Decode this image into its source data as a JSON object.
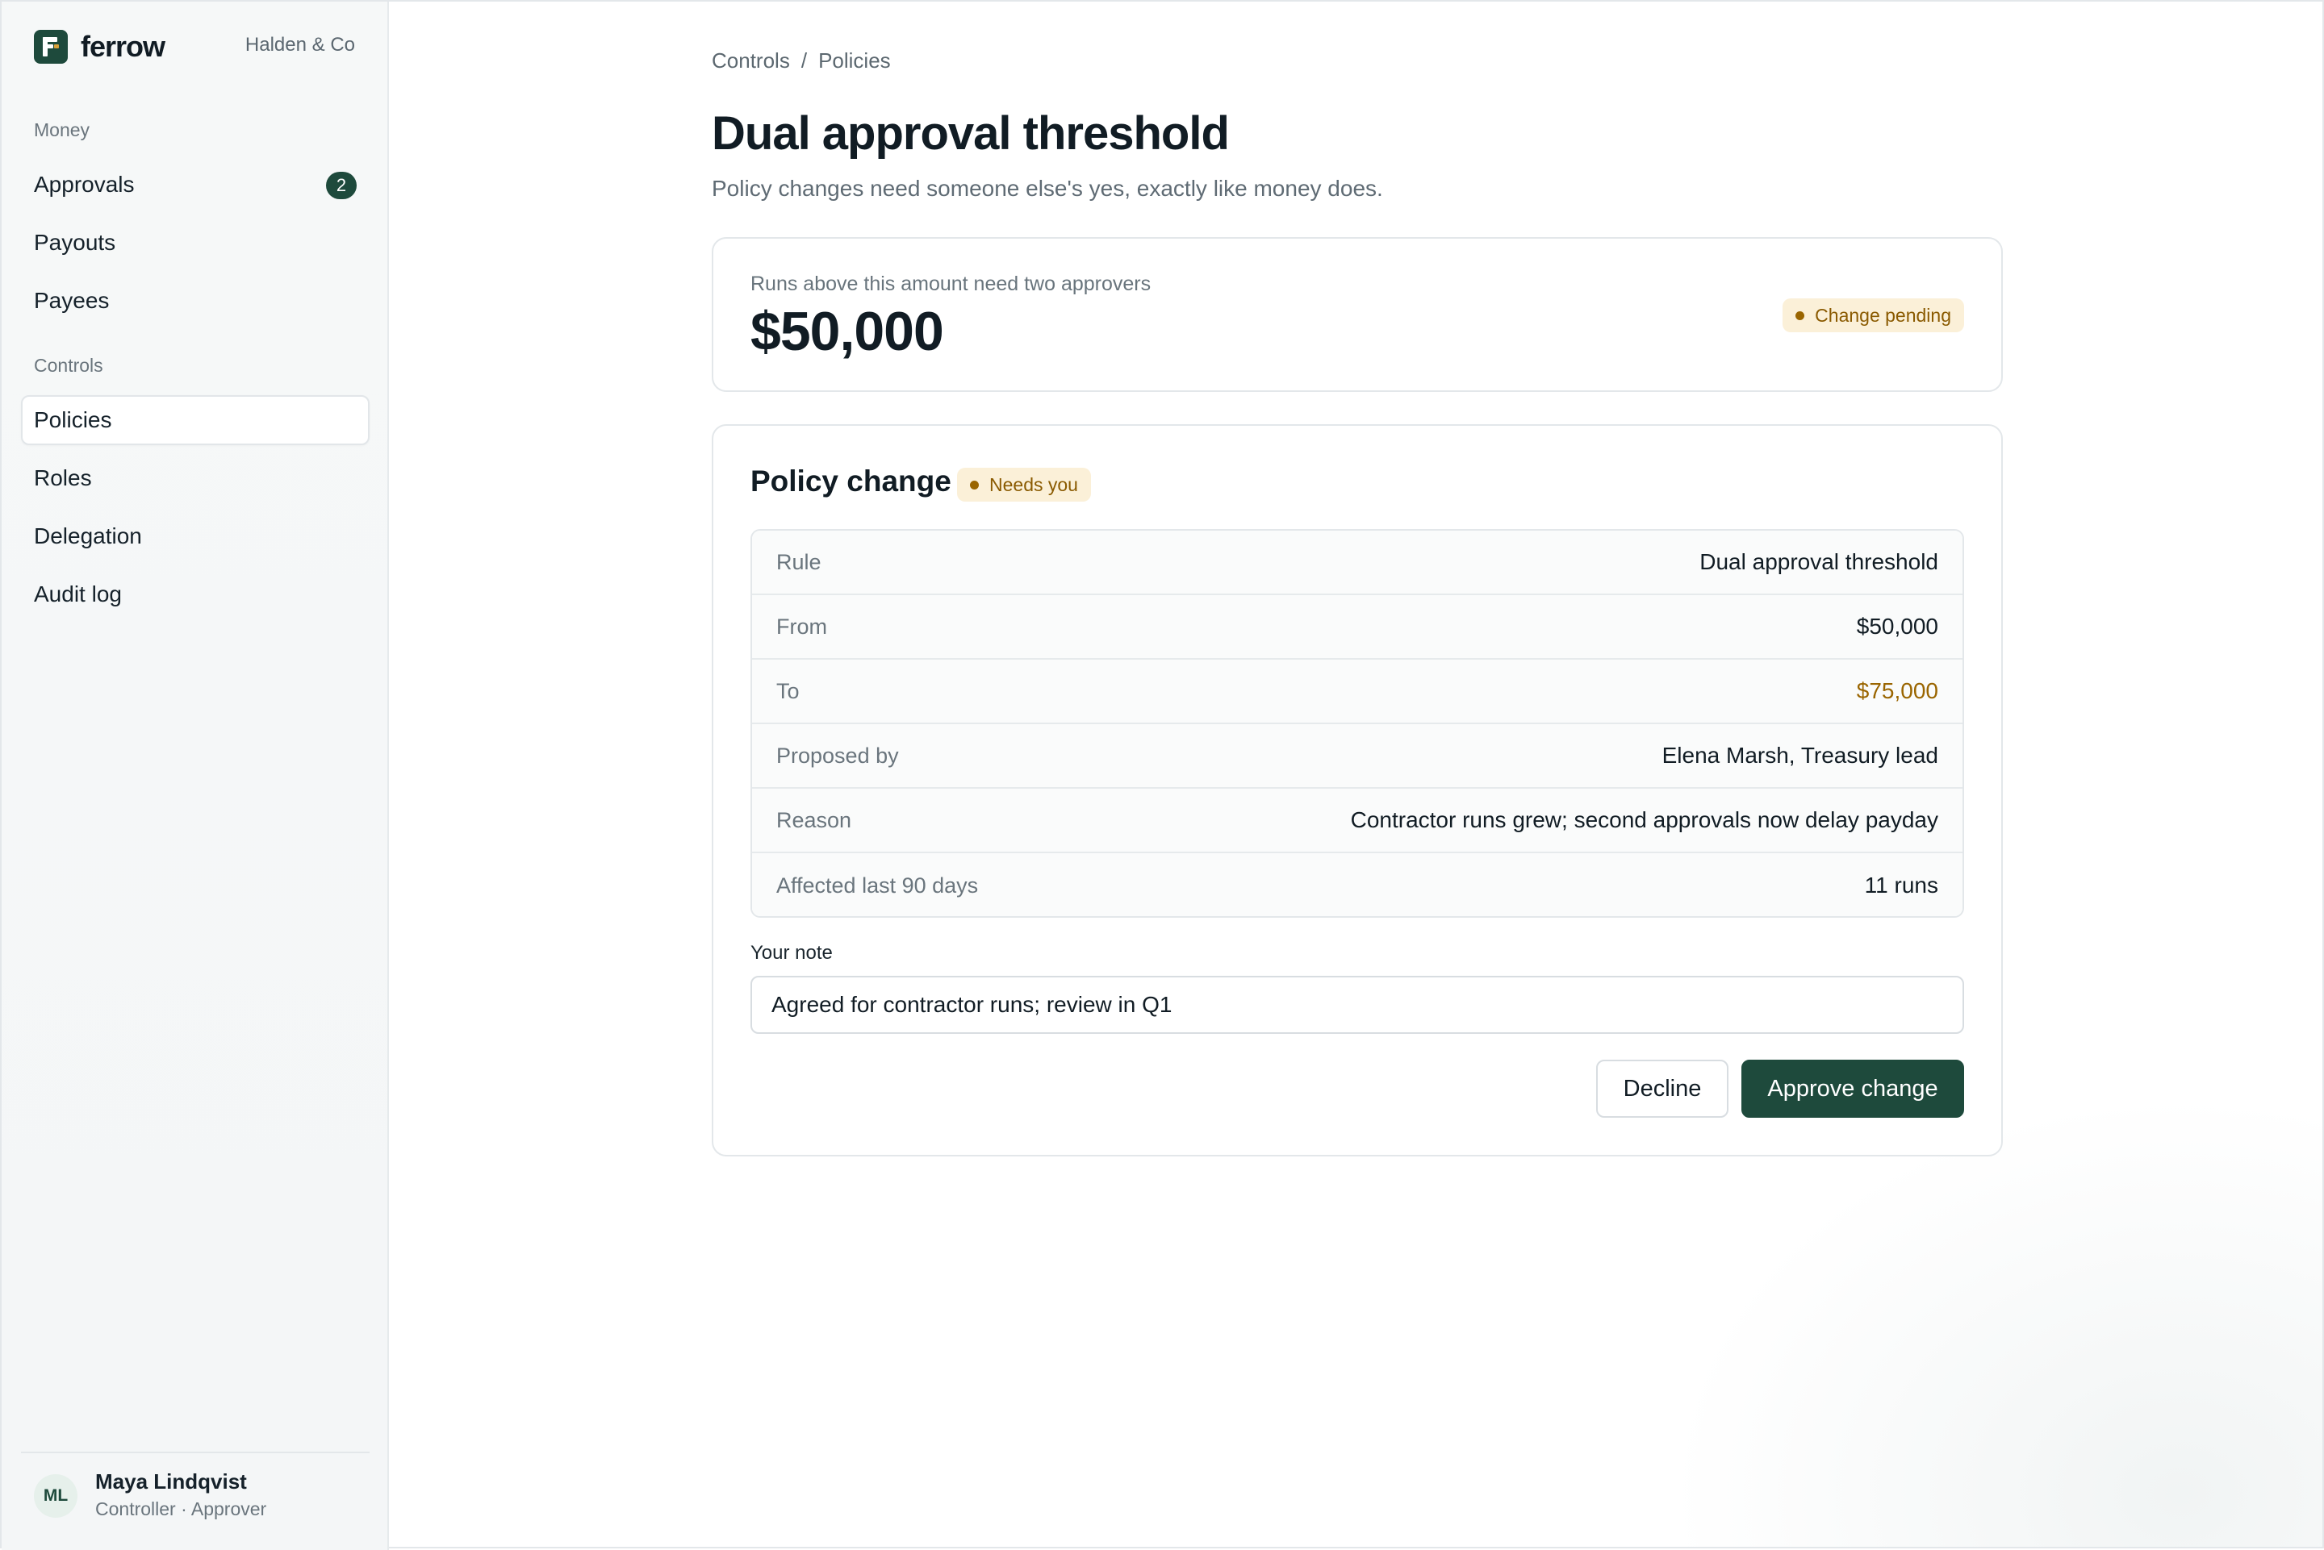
{
  "app": {
    "brand_name": "ferrow",
    "org_name": "Halden & Co"
  },
  "sidebar": {
    "sections": [
      {
        "label": "Money"
      },
      {
        "label": "Controls"
      }
    ],
    "items": [
      {
        "label": "Approvals",
        "badge": "2"
      },
      {
        "label": "Payouts"
      },
      {
        "label": "Payees"
      },
      {
        "label": "Policies",
        "active": true
      },
      {
        "label": "Roles"
      },
      {
        "label": "Delegation"
      },
      {
        "label": "Audit log"
      }
    ],
    "user": {
      "initials": "ML",
      "name": "Maya Lindqvist",
      "role": "Controller · Approver"
    }
  },
  "breadcrumb": {
    "items": [
      "Controls",
      "Policies"
    ],
    "separator": "/"
  },
  "page": {
    "title": "Dual approval threshold",
    "subtitle": "Policy changes need someone else's yes, exactly like money does."
  },
  "threshold_card": {
    "label": "Runs above this amount need two approvers",
    "amount": "$50,000",
    "status": "Change pending"
  },
  "change_card": {
    "heading": "Policy change",
    "status": "Needs you",
    "rows": [
      {
        "key": "Rule",
        "value": "Dual approval threshold"
      },
      {
        "key": "From",
        "value": "$50,000"
      },
      {
        "key": "To",
        "value": "$75,000"
      },
      {
        "key": "Proposed by",
        "value": "Elena Marsh, Treasury lead"
      },
      {
        "key": "Reason",
        "value": "Contractor runs grew; second approvals now delay payday"
      },
      {
        "key": "Affected last 90 days",
        "value": "11 runs"
      }
    ],
    "note_label": "Your note",
    "note_value": "Agreed for contractor runs; review in Q1",
    "decline_label": "Decline",
    "approve_label": "Approve change"
  },
  "colors": {
    "brand": "#1e4a3c",
    "pending_bg": "#fbf0d8",
    "pending_text": "#8a5a00",
    "accent_value": "#9a6500"
  }
}
